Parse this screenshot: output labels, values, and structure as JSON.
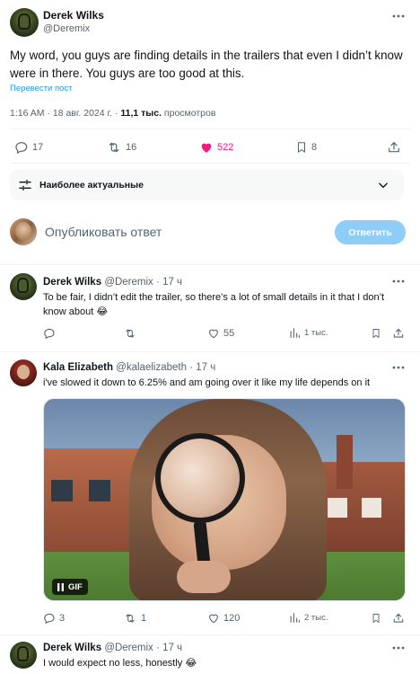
{
  "main_post": {
    "author_name": "Derek Wilks",
    "author_handle": "@Deremix",
    "text": "My word, you guys are finding details in the trailers that even I didn’t know were in there. You guys are too good at this.",
    "translate_link": "Перевести пост",
    "time": "1:16 AM",
    "date": "18 авг. 2024 г.",
    "views_count": "11,1 тыс.",
    "views_label": "просмотров",
    "replies": "17",
    "reposts": "16",
    "likes": "522",
    "bookmarks": "8",
    "like_color": "#f91880"
  },
  "sort": {
    "label": "Наиболее актуальные"
  },
  "reply_box": {
    "placeholder": "Опубликовать ответ",
    "button": "Ответить",
    "button_color": "#8ecdf8"
  },
  "replies": [
    {
      "author_name": "Derek Wilks",
      "author_handle": "@Deremix",
      "time": "17 ч",
      "text": "To be fair, I didn’t edit the trailer, so there’s a lot of small details in it that I don’t know about 😂",
      "replies": "",
      "reposts": "",
      "likes": "55",
      "views": "1 тыс."
    },
    {
      "author_name": "Kala Elizabeth",
      "author_handle": "@kalaelizabeth",
      "time": "17 ч",
      "text": "i've slowed it down to 6.25% and am going over it like my life depends on it",
      "media_badge": "GIF",
      "replies": "3",
      "reposts": "1",
      "likes": "120",
      "views": "2 тыс."
    },
    {
      "author_name": "Derek Wilks",
      "author_handle": "@Deremix",
      "time": "17 ч",
      "text": "I would expect no less, honestly 😂"
    }
  ],
  "separator": "·"
}
